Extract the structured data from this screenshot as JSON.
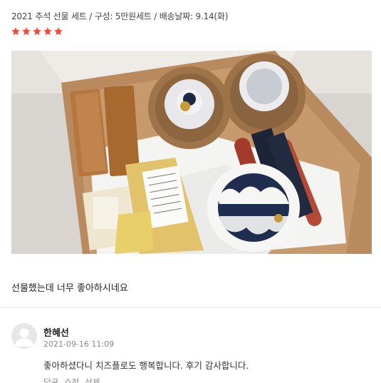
{
  "review": {
    "meta": "2021 추석 선물 세트 / 구성: 5만원세트 / 배송날짜: 9.14(화)",
    "rating": 5,
    "star_color": "#f0493e",
    "text": "선물했는데 너무 좋아하시네요"
  },
  "reply": {
    "author": "한혜선",
    "date": "2021-09-16 11:09",
    "text": "좋아하셨다니 치즈플로도 행복합니다. 후기 감사합니다.",
    "actions": [
      "답글",
      "수정",
      "삭제"
    ]
  }
}
